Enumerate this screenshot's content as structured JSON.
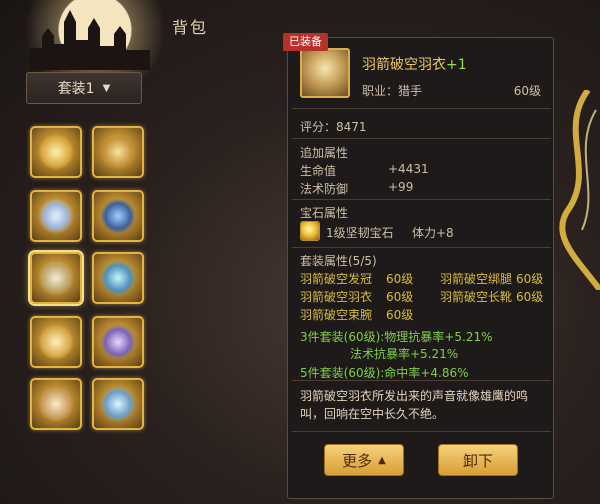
{
  "window": {
    "title": "背包"
  },
  "set_selector": {
    "label": "套装1"
  },
  "slots": [
    {
      "name": "slot-head"
    },
    {
      "name": "slot-shoulder"
    },
    {
      "name": "slot-weapon"
    },
    {
      "name": "slot-ring"
    },
    {
      "name": "slot-armor"
    },
    {
      "name": "slot-necklace"
    },
    {
      "name": "slot-leg"
    },
    {
      "name": "slot-bracelet"
    },
    {
      "name": "slot-boots"
    },
    {
      "name": "slot-earring"
    }
  ],
  "tooltip": {
    "equipped_tag": "已装备",
    "item": {
      "name": "羽箭破空羽衣",
      "enhance": "+1",
      "job": "职业：猎手",
      "level": "60级"
    },
    "score": "评分：8471",
    "extra_attrs": {
      "title": "追加属性",
      "rows": [
        {
          "label": "生命值",
          "value": "+4431"
        },
        {
          "label": "法术防御",
          "value": "+99"
        }
      ]
    },
    "gem": {
      "title": "宝石属性",
      "name": "1级坚韧宝石",
      "bonus": "体力+8"
    },
    "set": {
      "title": "套装属性(5/5)",
      "pieces": [
        {
          "name": "羽箭破空发冠",
          "level": "60级"
        },
        {
          "name": "羽箭破空绑腿",
          "level": "60级"
        },
        {
          "name": "羽箭破空羽衣",
          "level": "60级"
        },
        {
          "name": "羽箭破空长靴",
          "level": "60级"
        },
        {
          "name": "羽箭破空束腕",
          "level": "60级"
        }
      ],
      "bonus3_line1": "3件套装(60级):物理抗暴率+5.21%",
      "bonus3_line2": "法术抗暴率+5.21%",
      "bonus5": "5件套装(60级):命中率+4.86%"
    },
    "description": "羽箭破空羽衣所发出来的声音就像雄鹰的鸣叫，回响在空中长久不绝。",
    "buttons": {
      "more": "更多",
      "unequip": "卸下"
    }
  }
}
